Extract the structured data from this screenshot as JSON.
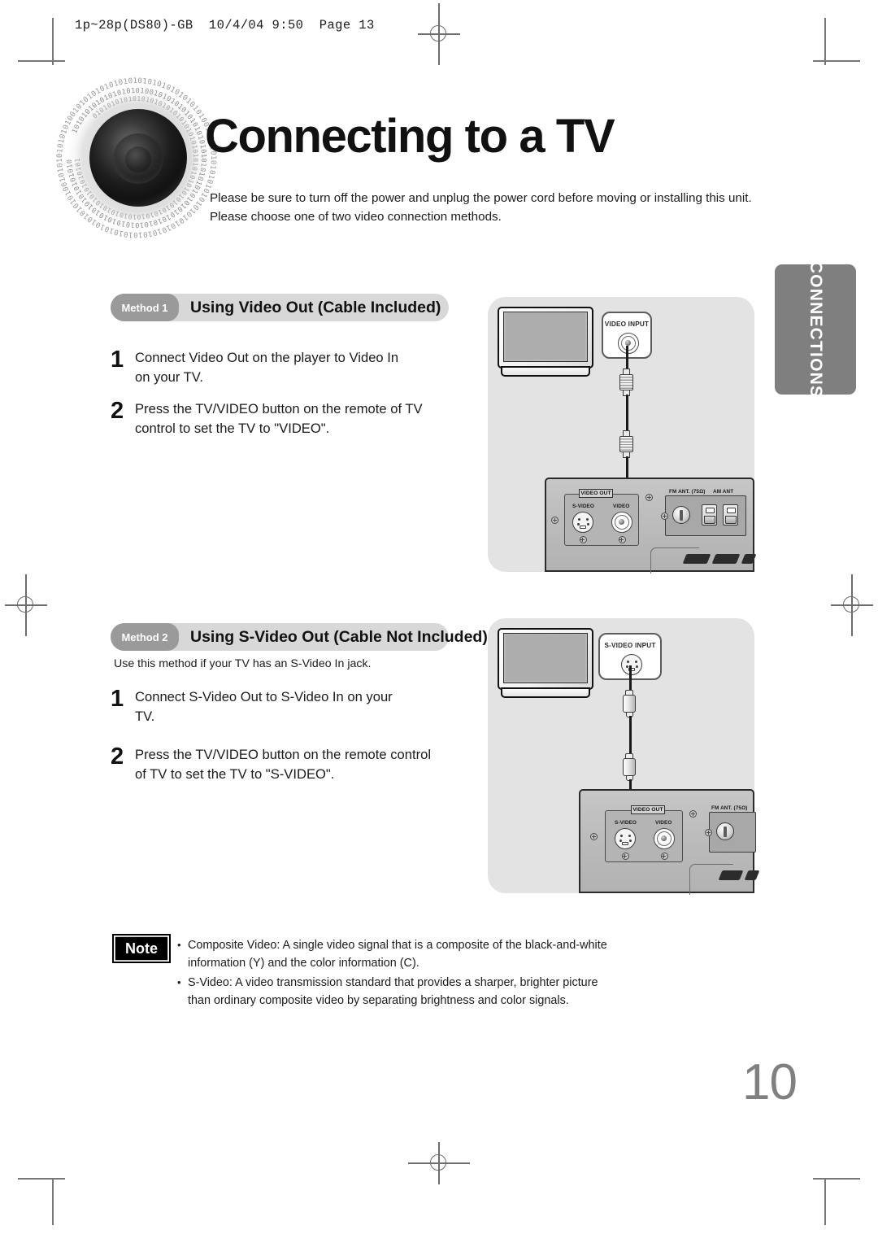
{
  "print_header": "1p~28p(DS80)-GB  10/4/04 9:50  Page 13",
  "title": "Connecting to a TV",
  "intro": {
    "line1": "Please be sure to turn off the power and unplug the power cord before moving or installing this unit.",
    "line2": "Please choose one of two video connection methods."
  },
  "side_tab": {
    "label": "CONNECTIONS",
    "color": "#7f7f7f"
  },
  "method1": {
    "badge": "Method 1",
    "title": "Using Video Out (Cable Included)",
    "steps": [
      {
        "num": "1",
        "text": "Connect Video Out on the player to Video In\non your TV."
      },
      {
        "num": "2",
        "text": "Press the TV/VIDEO button on the remote of TV\ncontrol to set the TV to \"VIDEO\"."
      }
    ],
    "diagram": {
      "tv_label": "",
      "input_jack_label": "VIDEO INPUT",
      "rear_panel": {
        "video_out_label": "VIDEO OUT",
        "svideo_label": "S-VIDEO",
        "video_label": "VIDEO",
        "fm_ant_label": "FM ANT. (75Ω)",
        "am_ant_label": "AM ANT"
      }
    }
  },
  "method2": {
    "badge": "Method 2",
    "title": "Using S-Video Out (Cable Not Included)",
    "subnote": "Use this method if your TV has an S-Video In jack.",
    "steps": [
      {
        "num": "1",
        "text": "Connect S-Video Out to S-Video In on your\nTV."
      },
      {
        "num": "2",
        "text": "Press the TV/VIDEO button on the remote control\nof TV to set the TV to \"S-VIDEO\"."
      }
    ],
    "diagram": {
      "input_jack_label": "S-VIDEO INPUT",
      "rear_panel": {
        "video_out_label": "VIDEO OUT",
        "svideo_label": "S-VIDEO",
        "video_label": "VIDEO",
        "fm_ant_label": "FM ANT. (75Ω)"
      }
    }
  },
  "note": {
    "badge": "Note",
    "items": [
      "Composite Video: A single video signal that is a composite of the black-and-white\ninformation (Y) and the color information (C).",
      "S-Video: A video transmission standard that provides a sharper, brighter picture\nthan ordinary composite video by separating brightness and color signals."
    ]
  },
  "page_number": "10"
}
